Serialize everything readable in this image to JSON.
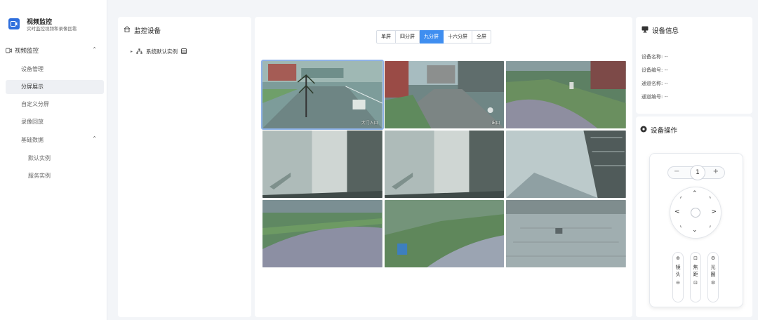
{
  "app": {
    "title": "视频监控",
    "subtitle": "实时监控视频和录像回看"
  },
  "sidebar": {
    "group_label": "视频监控",
    "items": [
      {
        "label": "设备管理",
        "active": false
      },
      {
        "label": "分屏展示",
        "active": true
      },
      {
        "label": "自定义分屏",
        "active": false
      },
      {
        "label": "录像回放",
        "active": false
      }
    ],
    "sub_group_label": "基础数据",
    "sub_items": [
      {
        "label": "默认实例"
      },
      {
        "label": "服务实例"
      }
    ]
  },
  "device_panel": {
    "title": "监控设备",
    "tree_root": "系统默认实例"
  },
  "view_tabs": {
    "items": [
      "单屏",
      "四分屏",
      "九分屏",
      "十六分屏",
      "全屏"
    ],
    "active": "九分屏"
  },
  "video_grid": {
    "layout": "3x3",
    "selected_index": 0,
    "cells": [
      {
        "scene": "plaza-tree",
        "label": "大门入口"
      },
      {
        "scene": "street-buildings",
        "label": "出口"
      },
      {
        "scene": "courtyard-path",
        "label": ""
      },
      {
        "scene": "stairwell",
        "label": ""
      },
      {
        "scene": "stairwell",
        "label": ""
      },
      {
        "scene": "building-corner",
        "label": ""
      },
      {
        "scene": "courtyard-lawn",
        "label": ""
      },
      {
        "scene": "lawn-path",
        "label": ""
      },
      {
        "scene": "paved-yard",
        "label": ""
      }
    ]
  },
  "device_info": {
    "title": "设备信息",
    "rows": [
      {
        "label": "设备名称:",
        "value": "--"
      },
      {
        "label": "设备编号:",
        "value": "--"
      },
      {
        "label": "通道名称:",
        "value": "--"
      },
      {
        "label": "通道编号:",
        "value": "--"
      }
    ]
  },
  "device_ops": {
    "title": "设备操作",
    "zoom_value": "1",
    "minus": "−",
    "plus": "+",
    "lens_controls": [
      {
        "label": "镜头"
      },
      {
        "label": "焦距"
      },
      {
        "label": "光圈"
      }
    ]
  },
  "colors": {
    "accent": "#3f8ef0",
    "brand": "#2f6fdd",
    "sidebar_active_bg": "#eef0f4"
  }
}
